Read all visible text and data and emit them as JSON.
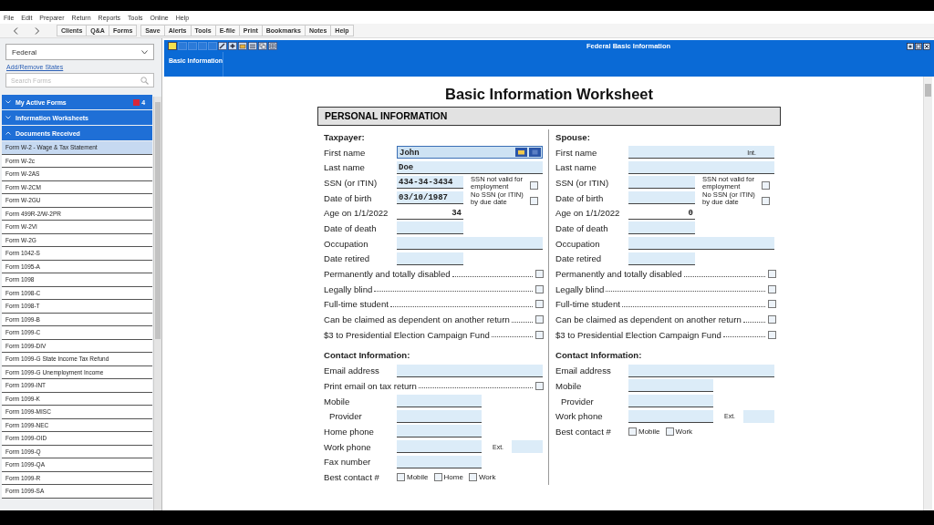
{
  "menu": [
    "File",
    "Edit",
    "Preparer",
    "Return",
    "Reports",
    "Tools",
    "Online",
    "Help"
  ],
  "toolbar": {
    "groups": [
      [
        "Clients",
        "Q&A",
        "Forms"
      ],
      [
        "Save",
        "Alerts",
        "Tools",
        "E-file",
        "Print",
        "Bookmarks",
        "Notes",
        "Help"
      ]
    ]
  },
  "sidebar": {
    "jurisdiction": "Federal",
    "link": "Add/Remove States",
    "search": {
      "placeholder": "Search Forms"
    },
    "sections": [
      {
        "label": "My Active Forms",
        "expanded": false,
        "badge": "4"
      },
      {
        "label": "Information Worksheets",
        "expanded": false
      },
      {
        "label": "Documents Received",
        "expanded": true
      }
    ],
    "forms": [
      {
        "label": "Form W-2 - Wage & Tax Statement",
        "selected": true
      },
      {
        "label": "Form W-2c",
        "selected": false
      },
      {
        "label": "Form W-2AS",
        "selected": false
      },
      {
        "label": "Form W-2CM",
        "selected": false
      },
      {
        "label": "Form W-2GU",
        "selected": false
      },
      {
        "label": "Form 499R-2/W-2PR",
        "selected": false
      },
      {
        "label": "Form W-2VI",
        "selected": false
      },
      {
        "label": "Form W-2G",
        "selected": false
      },
      {
        "label": "Form 1042-S",
        "selected": false
      },
      {
        "label": "Form 1095-A",
        "selected": false
      },
      {
        "label": "Form 1098",
        "selected": false
      },
      {
        "label": "Form 1098-C",
        "selected": false
      },
      {
        "label": "Form 1098-T",
        "selected": false
      },
      {
        "label": "Form 1099-B",
        "selected": false
      },
      {
        "label": "Form 1099-C",
        "selected": false
      },
      {
        "label": "Form 1099-DIV",
        "selected": false
      },
      {
        "label": "Form 1099-G State Income Tax Refund",
        "selected": false
      },
      {
        "label": "Form 1099-G Unemployment Income",
        "selected": false
      },
      {
        "label": "Form 1099-INT",
        "selected": false
      },
      {
        "label": "Form 1099-K",
        "selected": false
      },
      {
        "label": "Form 1099-MISC",
        "selected": false
      },
      {
        "label": "Form 1099-NEC",
        "selected": false
      },
      {
        "label": "Form 1099-OID",
        "selected": false
      },
      {
        "label": "Form 1099-Q",
        "selected": false
      },
      {
        "label": "Form 1099-QA",
        "selected": false
      },
      {
        "label": "Form 1099-R",
        "selected": false
      },
      {
        "label": "Form 1099-SA",
        "selected": false
      }
    ]
  },
  "window": {
    "title": "Federal Basic Information",
    "tabs": [
      {
        "label": "Basic Information",
        "selected": true
      }
    ]
  },
  "worksheet": {
    "title": "Basic Information Worksheet",
    "section": "PERSONAL INFORMATION",
    "columns": [
      {
        "rows": [
          {
            "kind": "heading",
            "label": "Taxpayer:"
          },
          {
            "kind": "long",
            "label": "First name",
            "value": "John",
            "focused": true
          },
          {
            "kind": "long",
            "label": "Last name",
            "value": "Doe"
          },
          {
            "kind": "short",
            "label": "SSN (or ITIN)",
            "value": "434-34-3434",
            "side": {
              "label": "SSN not valid for employment",
              "checked": false
            }
          },
          {
            "kind": "short",
            "label": "Date of birth",
            "value": "03/10/1987",
            "side": {
              "label": "No SSN (or ITIN) by due date",
              "checked": false
            }
          },
          {
            "kind": "number",
            "label": "Age on 1/1/2022",
            "value": "34"
          },
          {
            "kind": "short",
            "label": "Date of death"
          },
          {
            "kind": "long",
            "label": "Occupation"
          },
          {
            "kind": "short",
            "label": "Date retired"
          },
          {
            "kind": "check",
            "label": "Permanently and totally disabled",
            "checked": false
          },
          {
            "kind": "check",
            "label": "Legally blind",
            "checked": false
          },
          {
            "kind": "check",
            "label": "Full-time student",
            "checked": false
          },
          {
            "kind": "check",
            "label": "Can be claimed as dependent on another return",
            "checked": false
          },
          {
            "kind": "check",
            "label": "$3 to Presidential Election Campaign Fund",
            "checked": false
          },
          {
            "kind": "heading",
            "label": "Contact Information:"
          },
          {
            "kind": "long",
            "label": "Email address"
          },
          {
            "kind": "check",
            "label": "Print email on tax return",
            "checked": false
          },
          {
            "kind": "medium",
            "label": "Mobile"
          },
          {
            "kind": "indented",
            "label": "Provider"
          },
          {
            "kind": "medium",
            "label": "Home phone"
          },
          {
            "kind": "medium",
            "label": "Work phone",
            "ext": "Ext."
          },
          {
            "kind": "medium",
            "label": "Fax number"
          },
          {
            "kind": "choice",
            "label": "Best contact #",
            "options": [
              {
                "label": "Mobile",
                "checked": false
              },
              {
                "label": "Home",
                "checked": false
              },
              {
                "label": "Work",
                "checked": false
              }
            ]
          }
        ]
      },
      {
        "rows": [
          {
            "kind": "heading",
            "label": "Spouse:"
          },
          {
            "kind": "long",
            "label": "First name",
            "initial": "Int.",
            "focused": false
          },
          {
            "kind": "long",
            "label": "Last name"
          },
          {
            "kind": "short",
            "label": "SSN (or ITIN)",
            "side": {
              "label": "SSN not valid for employment",
              "checked": false
            }
          },
          {
            "kind": "short",
            "label": "Date of birth",
            "side": {
              "label": "No SSN (or ITIN) by due date",
              "checked": false
            }
          },
          {
            "kind": "number",
            "label": "Age on 1/1/2022",
            "value": "0"
          },
          {
            "kind": "short",
            "label": "Date of death"
          },
          {
            "kind": "long",
            "label": "Occupation"
          },
          {
            "kind": "short",
            "label": "Date retired"
          },
          {
            "kind": "check",
            "label": "Permanently and totally disabled",
            "checked": false
          },
          {
            "kind": "check",
            "label": "Legally blind",
            "checked": false
          },
          {
            "kind": "check",
            "label": "Full-time student",
            "checked": false
          },
          {
            "kind": "check",
            "label": "Can be claimed as dependent on another return",
            "checked": false
          },
          {
            "kind": "check",
            "label": "$3 to Presidential Election Campaign Fund",
            "checked": false
          },
          {
            "kind": "heading",
            "label": "Contact Information:"
          },
          {
            "kind": "long",
            "label": "Email address"
          },
          {
            "kind": "medium",
            "label": "Mobile"
          },
          {
            "kind": "indented",
            "label": "Provider"
          },
          {
            "kind": "medium",
            "label": "Work phone",
            "ext": "Ext."
          },
          {
            "kind": "choice",
            "label": "Best contact #",
            "options": [
              {
                "label": "Mobile",
                "checked": false
              },
              {
                "label": "Work",
                "checked": false
              }
            ]
          }
        ]
      }
    ]
  }
}
